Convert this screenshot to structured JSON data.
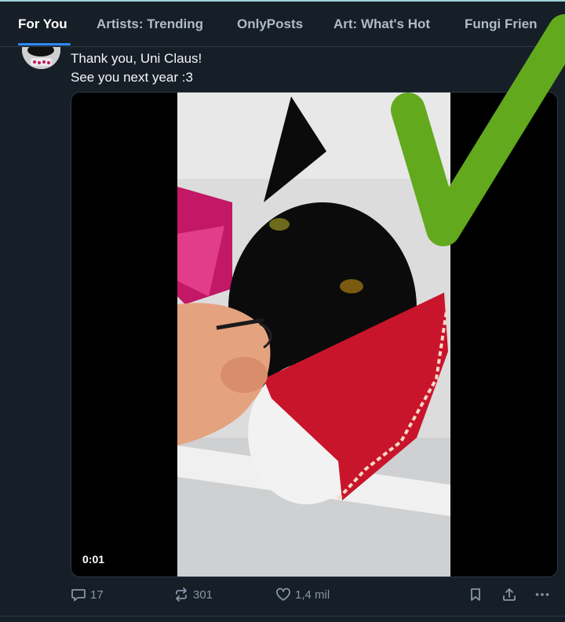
{
  "tabs": [
    {
      "label": "For You",
      "active": true
    },
    {
      "label": "Artists: Trending",
      "active": false
    },
    {
      "label": "OnlyPosts",
      "active": false
    },
    {
      "label": "Art: What's Hot",
      "active": false
    },
    {
      "label": "Fungi Frien",
      "active": false
    }
  ],
  "post": {
    "text_line1": "Thank you, Uni Claus!",
    "text_line2": "See you next year :3",
    "video": {
      "timestamp": "0:01"
    },
    "actions": {
      "replies": "17",
      "reposts": "301",
      "likes": "1,4 mil"
    }
  },
  "colors": {
    "background": "#161e27",
    "accent": "#2d8cff",
    "muted_text": "#8797a8",
    "overlay_check": "#62a91e"
  },
  "icons": [
    "reply-icon",
    "repost-icon",
    "like-icon",
    "bookmark-icon",
    "share-icon",
    "more-icon"
  ]
}
